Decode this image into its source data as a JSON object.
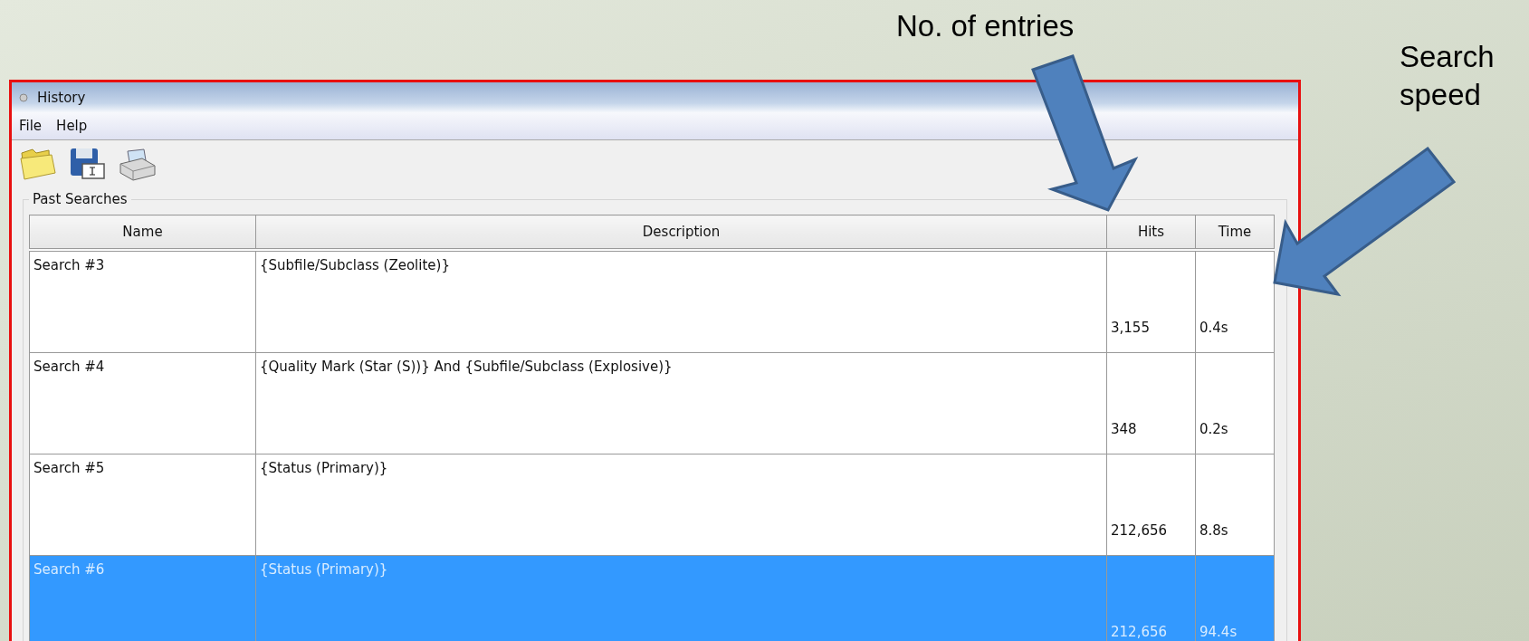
{
  "annotations": [
    {
      "kind": "entries",
      "label": "No. of entries"
    },
    {
      "kind": "speed",
      "label": "Search\nspeed"
    }
  ],
  "window": {
    "title": "History"
  },
  "menu": [
    "File",
    "Help"
  ],
  "toolbar": [
    {
      "kind": "open"
    },
    {
      "kind": "save"
    },
    {
      "kind": "print"
    }
  ],
  "group": {
    "title": "Past Searches"
  },
  "table": {
    "columns": [
      "Name",
      "Description",
      "Hits",
      "Time"
    ],
    "rows": [
      {
        "name": "Search #3",
        "description": "{Subfile/Subclass (Zeolite)}",
        "hits": "3,155",
        "time": "0.4s",
        "selected": false
      },
      {
        "name": "Search #4",
        "description": "{Quality Mark (Star (S))} And {Subfile/Subclass (Explosive)}",
        "hits": "348",
        "time": "0.2s",
        "selected": false
      },
      {
        "name": "Search #5",
        "description": "{Status (Primary)}",
        "hits": "212,656",
        "time": "8.8s",
        "selected": false
      },
      {
        "name": "Search #6",
        "description": "{Status (Primary)}",
        "hits": "212,656",
        "time": "94.4s",
        "selected": true
      }
    ]
  }
}
